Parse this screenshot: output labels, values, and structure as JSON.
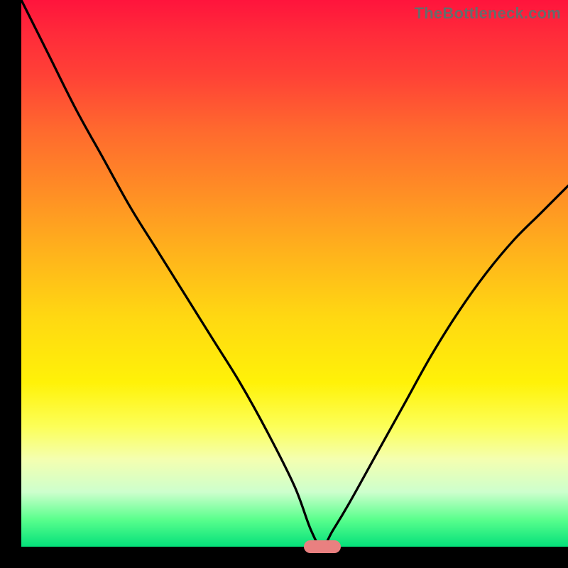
{
  "watermark": "TheBottleneck.com",
  "colors": {
    "frame_bg": "#000000",
    "watermark_text": "#6a6a6a",
    "curve_stroke": "#000000",
    "marker_fill": "#e98080",
    "gradient_stops": [
      {
        "pos": 0.0,
        "color": "#ff143c"
      },
      {
        "pos": 0.06,
        "color": "#ff2a3a"
      },
      {
        "pos": 0.14,
        "color": "#ff4236"
      },
      {
        "pos": 0.24,
        "color": "#ff6a2e"
      },
      {
        "pos": 0.34,
        "color": "#ff8a26"
      },
      {
        "pos": 0.46,
        "color": "#ffb21c"
      },
      {
        "pos": 0.58,
        "color": "#ffd812"
      },
      {
        "pos": 0.7,
        "color": "#fff208"
      },
      {
        "pos": 0.78,
        "color": "#fcff58"
      },
      {
        "pos": 0.84,
        "color": "#f4ffb0"
      },
      {
        "pos": 0.9,
        "color": "#cdffcd"
      },
      {
        "pos": 0.95,
        "color": "#5aff8d"
      },
      {
        "pos": 1.0,
        "color": "#04e07a"
      }
    ]
  },
  "chart_data": {
    "type": "line",
    "title": "",
    "xlabel": "",
    "ylabel": "",
    "xlim": [
      0,
      100
    ],
    "ylim": [
      0,
      100
    ],
    "x": [
      0,
      5,
      10,
      15,
      20,
      25,
      30,
      35,
      40,
      45,
      50,
      53,
      55,
      57,
      60,
      65,
      70,
      75,
      80,
      85,
      90,
      95,
      100
    ],
    "y": [
      100,
      90,
      80,
      71,
      62,
      54,
      46,
      38,
      30,
      21,
      11,
      3,
      0,
      3,
      8,
      17,
      26,
      35,
      43,
      50,
      56,
      61,
      66
    ],
    "marker": {
      "x": 55,
      "y": 0,
      "shape": "pill",
      "color": "#e98080"
    }
  }
}
